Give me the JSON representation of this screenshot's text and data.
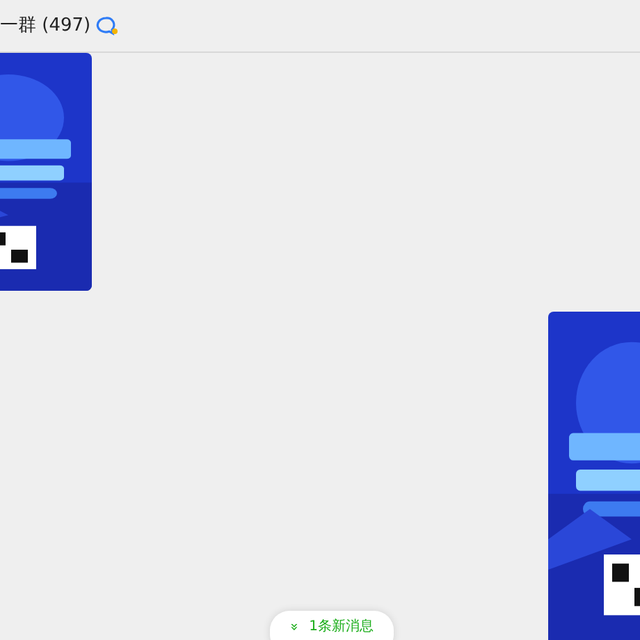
{
  "header": {
    "title": "一群 (497)"
  },
  "messages": [
    {
      "outgoing": false,
      "kind": "picture"
    },
    {
      "outgoing": true,
      "kind": "picture"
    }
  ],
  "new_messages": {
    "icon": "»",
    "label": "1条新消息"
  }
}
